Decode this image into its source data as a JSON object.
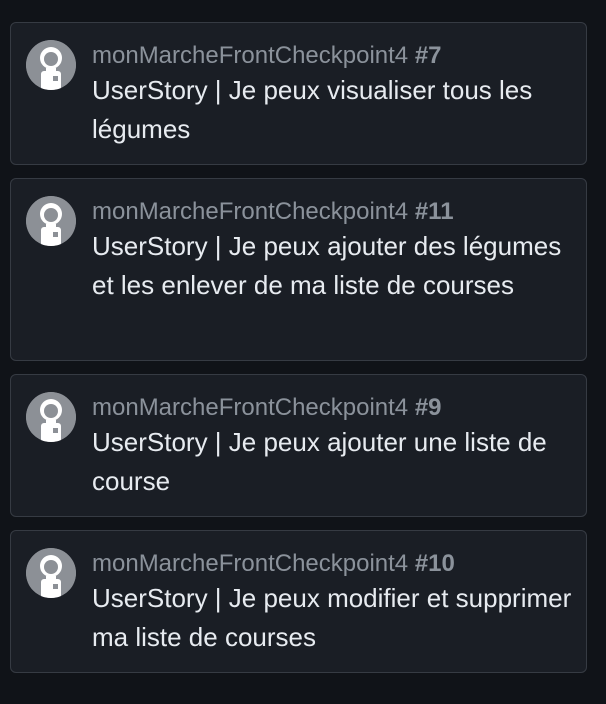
{
  "items": [
    {
      "repo": "monMarcheFrontCheckpoint4",
      "number": "#7",
      "title": "UserStory | Je peux visualiser tous les légumes"
    },
    {
      "repo": "monMarcheFrontCheckpoint4",
      "number": "#11",
      "title": "UserStory | Je peux ajouter des légumes et les enlever de ma liste de courses"
    },
    {
      "repo": "monMarcheFrontCheckpoint4",
      "number": "#9",
      "title": "UserStory | Je peux ajouter une liste de course"
    },
    {
      "repo": "monMarcheFrontCheckpoint4",
      "number": "#10",
      "title": "UserStory | Je peux modifier et supprimer ma liste de courses"
    }
  ],
  "icons": {
    "avatar": "avatar-icon"
  },
  "colors": {
    "background": "#101318",
    "card": "#1a1e25",
    "border": "#363b43",
    "muted_text": "#8b929b",
    "title_text": "#e7ebf0",
    "avatar": "#8c9096"
  }
}
